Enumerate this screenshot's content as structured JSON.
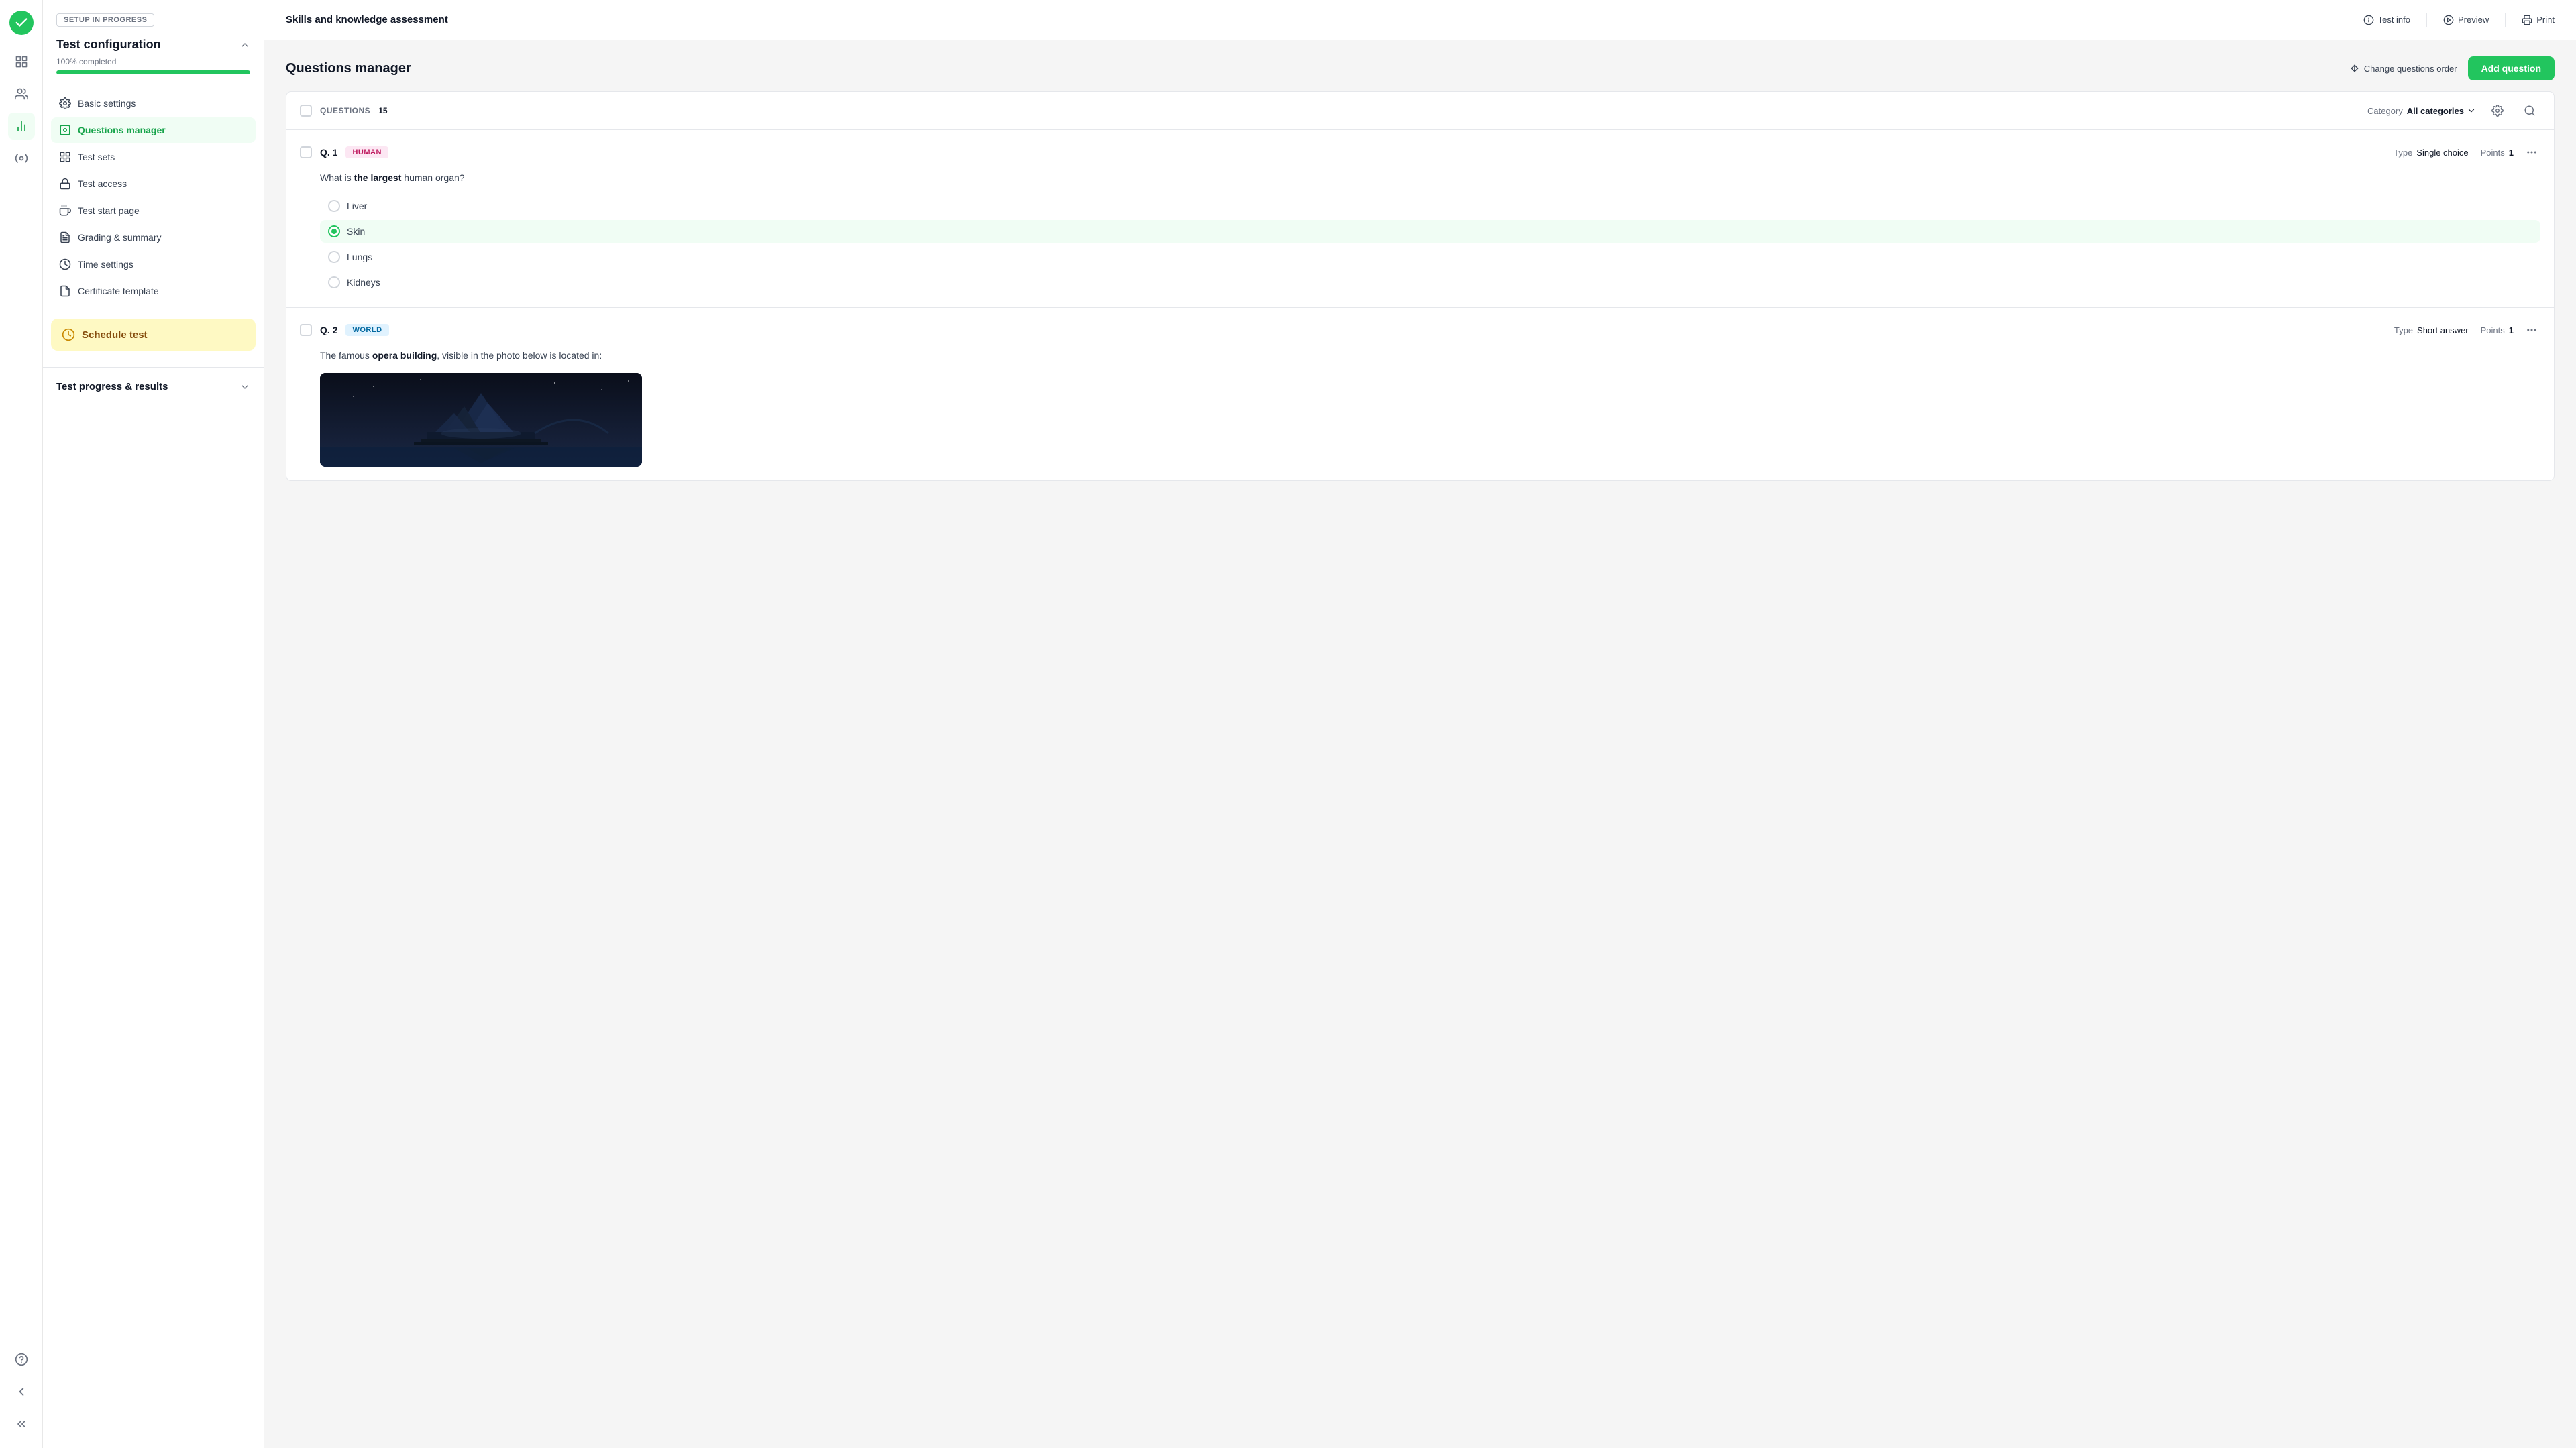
{
  "app": {
    "title": "Skills and knowledge assessment"
  },
  "topbar": {
    "test_info_label": "Test info",
    "preview_label": "Preview",
    "print_label": "Print"
  },
  "left_nav": {
    "setup_badge": "SETUP IN PROGRESS",
    "config_title": "Test configuration",
    "progress_label": "100% completed",
    "progress_percent": 100,
    "nav_items": [
      {
        "id": "basic-settings",
        "label": "Basic settings",
        "icon": "settings"
      },
      {
        "id": "questions-manager",
        "label": "Questions manager",
        "icon": "questions",
        "active": true
      },
      {
        "id": "test-sets",
        "label": "Test sets",
        "icon": "sets"
      },
      {
        "id": "test-access",
        "label": "Test access",
        "icon": "access"
      },
      {
        "id": "test-start-page",
        "label": "Test start page",
        "icon": "start"
      },
      {
        "id": "grading-summary",
        "label": "Grading & summary",
        "icon": "grading"
      },
      {
        "id": "time-settings",
        "label": "Time settings",
        "icon": "time"
      },
      {
        "id": "certificate-template",
        "label": "Certificate template",
        "icon": "certificate"
      }
    ],
    "schedule_btn_label": "Schedule test",
    "test_progress_section": "Test progress & results"
  },
  "questions_manager": {
    "title": "Questions manager",
    "change_order_label": "Change questions order",
    "add_question_label": "Add question",
    "questions_header_label": "QUESTIONS",
    "questions_count": 15,
    "category_label": "Category",
    "category_value": "All categories",
    "questions": [
      {
        "id": "q1",
        "number": "Q. 1",
        "tag": "HUMAN",
        "tag_type": "human",
        "type_label": "Type",
        "type": "Single choice",
        "points_label": "Points",
        "points": 1,
        "question_text_parts": [
          {
            "text": "What is ",
            "bold": false
          },
          {
            "text": "the largest",
            "bold": true
          },
          {
            "text": " human organ?",
            "bold": false
          }
        ],
        "options": [
          {
            "label": "Liver",
            "correct": false
          },
          {
            "label": "Skin",
            "correct": true
          },
          {
            "label": "Lungs",
            "correct": false
          },
          {
            "label": "Kidneys",
            "correct": false
          }
        ]
      },
      {
        "id": "q2",
        "number": "Q. 2",
        "tag": "WORLD",
        "tag_type": "world",
        "type_label": "Type",
        "type": "Short answer",
        "points_label": "Points",
        "points": 1,
        "question_text_parts": [
          {
            "text": "The famous ",
            "bold": false
          },
          {
            "text": "opera building",
            "bold": true
          },
          {
            "text": ", visible in the photo below is located in:",
            "bold": false
          }
        ],
        "has_image": true
      }
    ]
  }
}
